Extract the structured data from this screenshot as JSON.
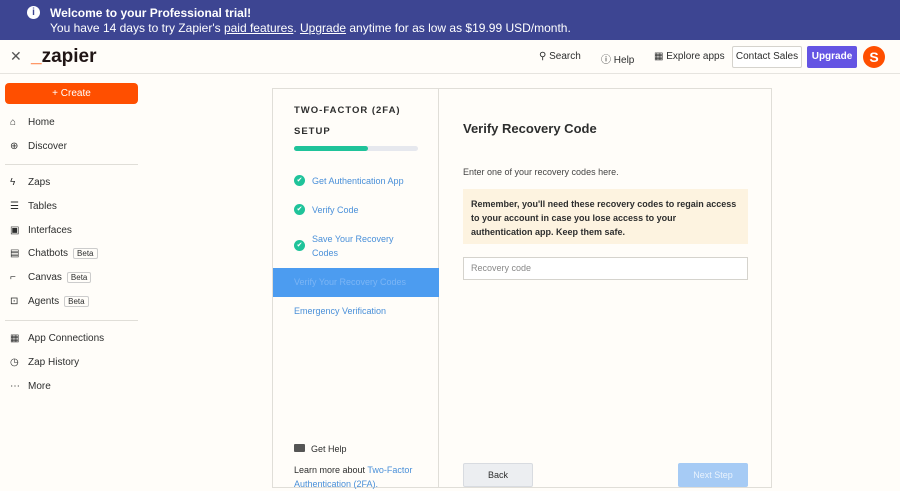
{
  "banner": {
    "title": "Welcome to your Professional trial!",
    "pre": "You have 14 days to try Zapier's ",
    "link1": "paid features",
    "mid": ". ",
    "link2": "Upgrade",
    "post": " anytime for as low as $19.99 USD/month."
  },
  "header": {
    "logo": "zapier",
    "search": "Search",
    "help": "Help",
    "explore": "Explore apps",
    "contact": "Contact Sales",
    "upgrade": "Upgrade"
  },
  "sidebar": {
    "create": "Create",
    "items": [
      {
        "label": "Home"
      },
      {
        "label": "Discover"
      },
      {
        "label": "Zaps"
      },
      {
        "label": "Tables"
      },
      {
        "label": "Interfaces"
      },
      {
        "label": "Chatbots",
        "badge": "Beta"
      },
      {
        "label": "Canvas",
        "badge": "Beta"
      },
      {
        "label": "Agents",
        "badge": "Beta"
      },
      {
        "label": "App Connections"
      },
      {
        "label": "Zap History"
      },
      {
        "label": "More"
      }
    ]
  },
  "setup": {
    "title1": "TWO-FACTOR (2FA)",
    "title2": "SETUP",
    "progress": 0.6,
    "steps": [
      "Get Authentication App",
      "Verify Code",
      "Save Your Recovery Codes",
      "Verify Your Recovery Codes",
      "Emergency Verification"
    ],
    "get_help": "Get Help",
    "learn_pre": "Learn more about ",
    "learn_link": "Two-Factor Authentication (2FA)."
  },
  "main": {
    "title": "Verify Recovery Code",
    "desc": "Enter one of your recovery codes here.",
    "warning": "Remember, you'll need these recovery codes to regain access to your account in case you lose access to your authentication app. Keep them safe.",
    "placeholder": "Recovery code",
    "back": "Back",
    "next": "Next Step"
  }
}
